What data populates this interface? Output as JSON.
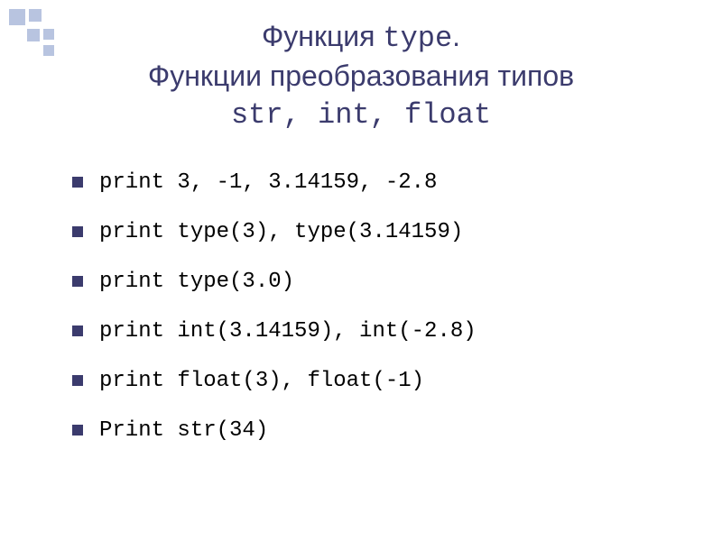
{
  "title": {
    "line1_prefix": "Функция ",
    "line1_mono": "type",
    "line1_suffix": ".",
    "line2": "Функции преобразования типов",
    "line3_mono": "str, int, float"
  },
  "bullets": [
    "print 3, -1, 3.14159, -2.8",
    "print type(3), type(3.14159)",
    "print type(3.0)",
    "print int(3.14159), int(-2.8)",
    "print float(3), float(-1)",
    "Print str(34)"
  ]
}
